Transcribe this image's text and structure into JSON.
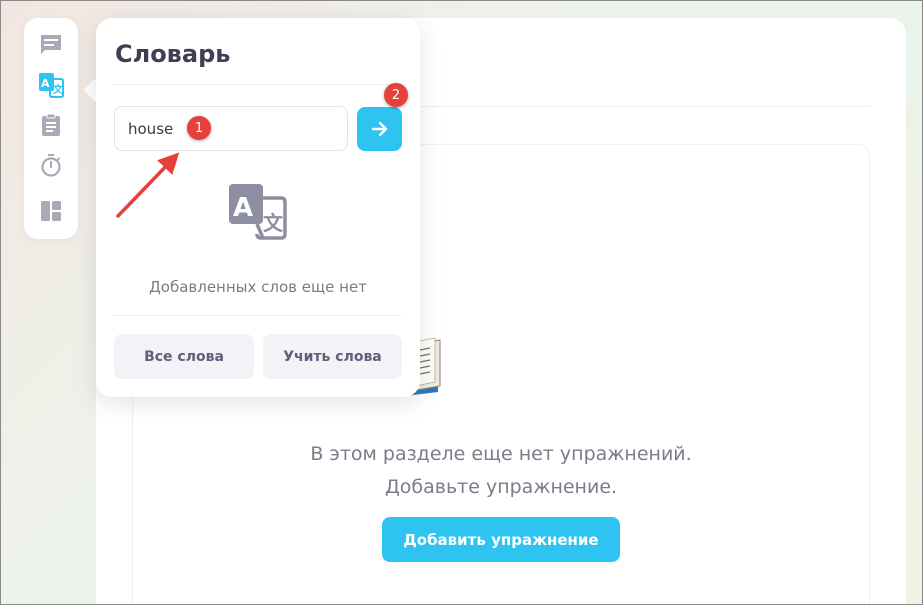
{
  "main": {
    "empty_line1": "В этом разделе еще нет упражнений.",
    "empty_line2": "Добавьте упражнение.",
    "add_exercise_label": "Добавить упражнение",
    "book_icon": "open-book-icon"
  },
  "rail": {
    "items": [
      {
        "icon": "chat-icon",
        "active": false
      },
      {
        "icon": "translate-icon",
        "active": true
      },
      {
        "icon": "clipboard-icon",
        "active": false
      },
      {
        "icon": "stopwatch-icon",
        "active": false
      },
      {
        "icon": "dashboard-icon",
        "active": false
      }
    ]
  },
  "dictionary": {
    "title": "Словарь",
    "input_value": "house",
    "submit_icon": "arrow-right-icon",
    "empty_text": "Добавленных слов еще нет",
    "all_words_label": "Все слова",
    "learn_words_label": "Учить слова"
  },
  "annotations": {
    "badge1": "1",
    "badge2": "2"
  },
  "colors": {
    "accent": "#2fc3f2",
    "badge": "#e5403a",
    "title": "#3e3f57",
    "muted": "#7b7b8c",
    "rail_icon": "#a9a9b8"
  }
}
